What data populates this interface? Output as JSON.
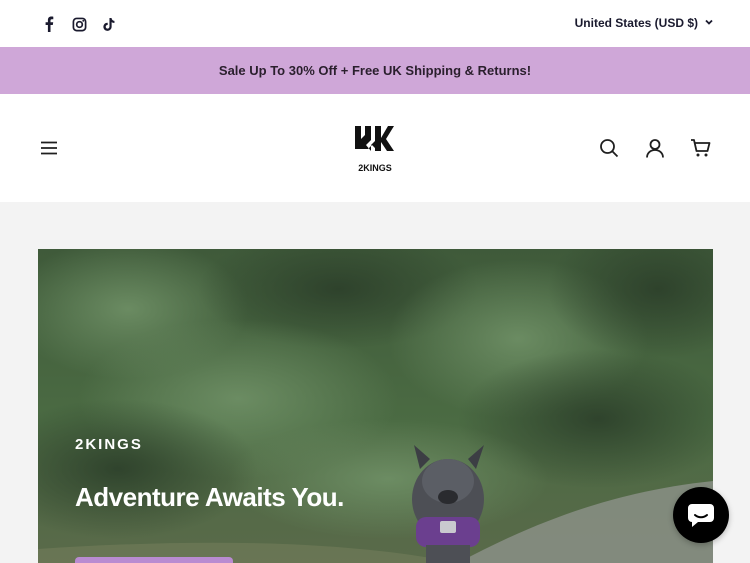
{
  "topbar": {
    "social": [
      {
        "icon": "facebook-icon"
      },
      {
        "icon": "instagram-icon"
      },
      {
        "icon": "tiktok-icon"
      }
    ],
    "currency_label": "United States (USD $)"
  },
  "announcement": {
    "text": "Sale Up To 30% Off + Free UK Shipping & Returns!",
    "background": "#cfa7d8"
  },
  "header": {
    "logo_text": "2KINGS",
    "icons": [
      "menu-icon",
      "search-icon",
      "account-icon",
      "cart-icon"
    ]
  },
  "hero": {
    "eyebrow": "2KINGS",
    "title": "Adventure Awaits You.",
    "accent_color": "#b98bd1"
  },
  "chat": {
    "icon": "chat-bubble-icon"
  }
}
